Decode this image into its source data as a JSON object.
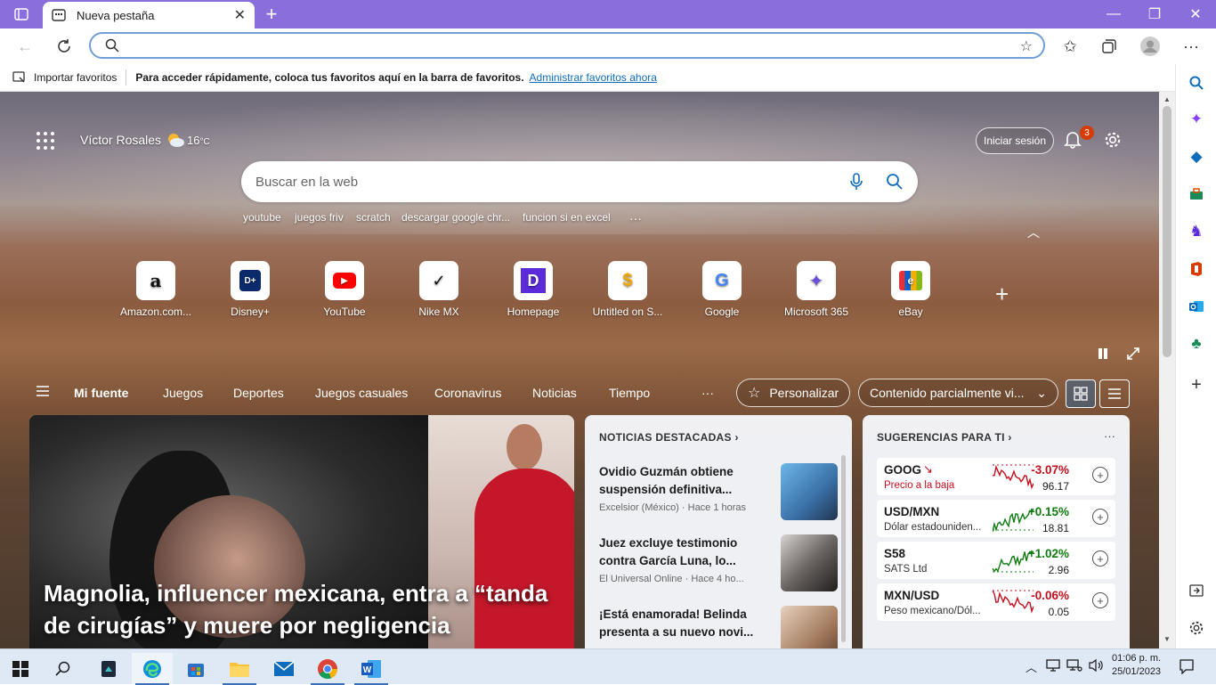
{
  "browser": {
    "tab_title": "Nueva pestaña",
    "address_value": "",
    "favorites_bar": {
      "import_label": "Importar favoritos",
      "hint": "Para acceder rápidamente, coloca tus favoritos aquí en la barra de favoritos.",
      "manage_link": "Administrar favoritos ahora"
    }
  },
  "header": {
    "user_name": "Víctor Rosales",
    "temperature": "16",
    "temp_unit": "°C",
    "sign_in": "Iniciar sesión",
    "notifications_count": "3"
  },
  "search": {
    "placeholder": "Buscar en la web",
    "quick_links": [
      "youtube",
      "juegos friv",
      "scratch",
      "descargar google chr...",
      "funcion si en excel"
    ],
    "more": "···"
  },
  "tiles": [
    {
      "label": "Amazon.com...",
      "icon": "a"
    },
    {
      "label": "Disney+",
      "icon": "D+"
    },
    {
      "label": "YouTube",
      "icon": "▶"
    },
    {
      "label": "Nike MX",
      "icon": "✓"
    },
    {
      "label": "Homepage",
      "icon": "D"
    },
    {
      "label": "Untitled on S...",
      "icon": "$"
    },
    {
      "label": "Google",
      "icon": "G"
    },
    {
      "label": "Microsoft 365",
      "icon": "✦"
    },
    {
      "label": "eBay",
      "icon": "e"
    }
  ],
  "add_tile": "+",
  "feed_nav": {
    "items": [
      "Mi fuente",
      "Juegos",
      "Deportes",
      "Juegos casuales",
      "Coronavirus",
      "Noticias",
      "Tiempo"
    ],
    "more": "···",
    "personalize": "Personalizar",
    "content_filter": "Contenido parcialmente vi..."
  },
  "hero": {
    "title": "Magnolia, influencer mexicana, entra a “tanda de cirugías” y muere por negligencia"
  },
  "top_news": {
    "header": "NOTICIAS DESTACADAS",
    "items": [
      {
        "headline": "Ovidio Guzmán obtiene suspensión definitiva...",
        "source": "Excelsior (México) · Hace 1 horas"
      },
      {
        "headline": "Juez excluye testimonio contra García Luna, lo...",
        "source": "El Universal Online · Hace 4 ho..."
      },
      {
        "headline": "¡Está enamorada! Belinda presenta a su nuevo novi...",
        "source": ""
      }
    ]
  },
  "suggestions": {
    "header": "SUGERENCIAS PARA TI",
    "more": "···",
    "stocks": [
      {
        "symbol": "GOOG",
        "sub": "Precio a la baja",
        "change": "-3.07%",
        "value": "96.17",
        "trend": "down"
      },
      {
        "symbol": "USD/MXN",
        "sub": "Dólar estadouniden...",
        "change": "+0.15%",
        "value": "18.81",
        "trend": "up"
      },
      {
        "symbol": "S58",
        "sub": "SATS Ltd",
        "change": "+1.02%",
        "value": "2.96",
        "trend": "up"
      },
      {
        "symbol": "MXN/USD",
        "sub": "Peso mexicano/Dól...",
        "change": "-0.06%",
        "value": "0.05",
        "trend": "down"
      }
    ]
  },
  "taskbar": {
    "time": "01:06 p. m.",
    "date": "25/01/2023"
  },
  "colors": {
    "title_bar": "#8a6fdc",
    "up": "#107c10",
    "down": "#c50f1f",
    "accent": "#0f6cbd"
  }
}
